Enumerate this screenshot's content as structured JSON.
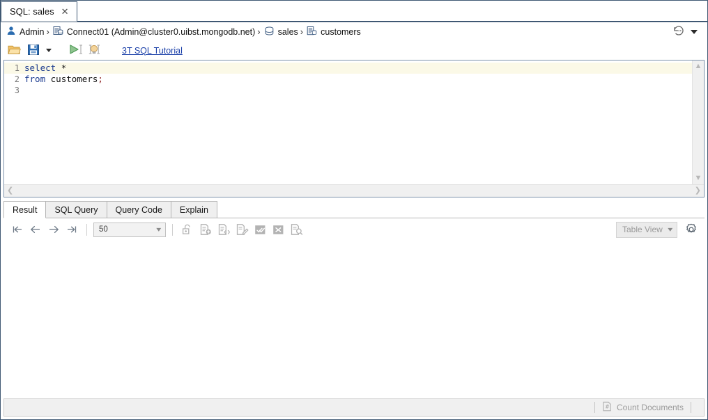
{
  "window": {
    "tab": {
      "label": "SQL: sales",
      "close_icon": "close-icon"
    }
  },
  "breadcrumb": {
    "user_icon": "user-icon",
    "user": "Admin",
    "sep": "›",
    "connection_icon": "server-icon",
    "connection": "Connect01 (Admin@cluster0.uibst.mongodb.net)",
    "database_icon": "database-icon",
    "database": "sales",
    "collection_icon": "collection-icon",
    "collection": "customers",
    "history_icon": "history-icon"
  },
  "toolbar": {
    "open_icon": "open-folder-icon",
    "save_icon": "save-icon",
    "save_dropdown_icon": "chevron-down-icon",
    "run_icon": "run-query-icon",
    "explain_icon": "lightbulb-hint-icon",
    "tutorial_link": "3T SQL Tutorial"
  },
  "editor": {
    "lines": [
      {
        "number": "1",
        "current": true,
        "tokens": [
          {
            "text": "select",
            "type": "kw"
          },
          {
            "text": " ",
            "type": "op"
          },
          {
            "text": "*",
            "type": "op"
          }
        ]
      },
      {
        "number": "2",
        "current": false,
        "tokens": [
          {
            "text": "from",
            "type": "kw"
          },
          {
            "text": " ",
            "type": "op"
          },
          {
            "text": "customers",
            "type": "ident"
          },
          {
            "text": ";",
            "type": "punct"
          }
        ]
      },
      {
        "number": "3",
        "current": false,
        "tokens": []
      }
    ],
    "scroll_up_icon": "chevron-up-icon",
    "scroll_down_icon": "chevron-down-icon",
    "scroll_left_icon": "chevron-left-icon",
    "scroll_right_icon": "chevron-right-icon",
    "cursor_icon": "text-ibeam-cursor"
  },
  "result": {
    "tabs": [
      {
        "label": "Result",
        "active": true
      },
      {
        "label": "SQL Query",
        "active": false
      },
      {
        "label": "Query Code",
        "active": false
      },
      {
        "label": "Explain",
        "active": false
      }
    ],
    "nav": {
      "first_icon": "go-first-icon",
      "prev_icon": "go-previous-icon",
      "next_icon": "go-next-icon",
      "last_icon": "go-last-icon"
    },
    "page_size": "50",
    "page_size_chevron": "chevron-down-icon",
    "actions": [
      {
        "icon": "unlock-icon",
        "name": "toggle-edit-lock-button"
      },
      {
        "icon": "add-document-icon",
        "name": "add-document-button"
      },
      {
        "icon": "clone-document-icon",
        "name": "clone-document-button"
      },
      {
        "icon": "edit-document-icon",
        "name": "edit-document-button"
      },
      {
        "icon": "confirm-changes-icon",
        "name": "confirm-changes-button"
      },
      {
        "icon": "discard-changes-icon",
        "name": "discard-changes-button"
      },
      {
        "icon": "find-document-icon",
        "name": "find-document-button"
      }
    ],
    "view_mode": "Table View",
    "view_mode_chevron": "chevron-down-icon",
    "settings_icon": "gear-icon"
  },
  "statusbar": {
    "count_documents_icon": "count-documents-icon",
    "count_documents_label": "Count Documents"
  },
  "colors": {
    "window_border": "#3f5873",
    "link": "#1a3fa8",
    "keyword": "#1a3a8f",
    "current_line": "#fbf9e7",
    "run_green": "#4f9b57",
    "bulb": "#f2d08a",
    "disabled_gray": "#9b9b9b"
  }
}
